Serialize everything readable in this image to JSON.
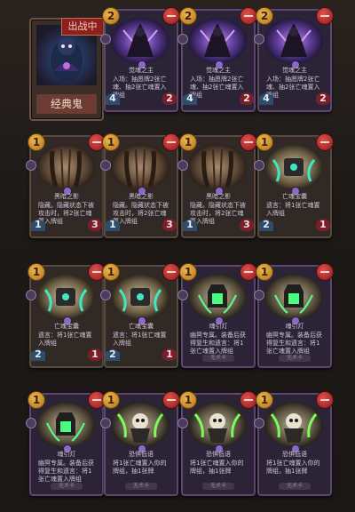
{
  "hero": {
    "tag": "出战中",
    "name": "经典鬼"
  },
  "cards": [
    {
      "cost": "2",
      "name": "觉魂之主",
      "desc": "入场：抽愿牌2张亡魂、抽2张亡魂置入牌组",
      "foot": "",
      "atk": "4",
      "hp": "2",
      "art": "violet",
      "frame": "purple"
    },
    {
      "cost": "2",
      "name": "觉魂之主",
      "desc": "入场：抽愿牌2张亡魂、抽2张亡魂置入牌组",
      "foot": "",
      "atk": "4",
      "hp": "2",
      "art": "violet",
      "frame": "purple"
    },
    {
      "cost": "2",
      "name": "觉魂之主",
      "desc": "入场：抽愿牌2张亡魂、抽2张亡魂置入牌组",
      "foot": "",
      "atk": "4",
      "hp": "2",
      "art": "violet",
      "frame": "purple"
    },
    {
      "cost": "1",
      "name": "黑暗之影",
      "desc": "隐藏。隐藏状态下被攻击时，将2张亡魂置入牌组",
      "foot": "",
      "atk": "1",
      "hp": "3",
      "art": "brown",
      "frame": "gold"
    },
    {
      "cost": "1",
      "name": "黑暗之影",
      "desc": "隐藏。隐藏状态下被攻击时，将2张亡魂置入牌组",
      "foot": "",
      "atk": "1",
      "hp": "3",
      "art": "brown",
      "frame": "gold"
    },
    {
      "cost": "1",
      "name": "黑暗之影",
      "desc": "隐藏。隐藏状态下被攻击时，将2张亡魂置入牌组",
      "foot": "",
      "atk": "1",
      "hp": "3",
      "art": "brown",
      "frame": "gold"
    },
    {
      "cost": "1",
      "name": "亡魂宝囊",
      "desc": "遗言：将1张亡魂置入牌组",
      "foot": "",
      "atk": "2",
      "hp": "1",
      "art": "teal",
      "frame": "gold"
    },
    {
      "cost": "1",
      "name": "亡魂宝囊",
      "desc": "遗言：将1张亡魂置入牌组",
      "foot": "",
      "atk": "2",
      "hp": "1",
      "art": "teal",
      "frame": "gold"
    },
    {
      "cost": "1",
      "name": "亡魂宝囊",
      "desc": "遗言：将1张亡魂置入牌组",
      "foot": "",
      "atk": "2",
      "hp": "1",
      "art": "teal",
      "frame": "gold"
    },
    {
      "cost": "1",
      "name": "魂引灯",
      "desc": "幽冥专属。装备后获得复生和遗言：将1张亡魂置入牌组",
      "foot": "无术卡",
      "atk": "",
      "hp": "",
      "art": "lantern",
      "frame": "purple"
    },
    {
      "cost": "1",
      "name": "魂引灯",
      "desc": "幽冥专属。装备后获得复生和遗言：将1张亡魂置入牌组",
      "foot": "无术卡",
      "atk": "",
      "hp": "",
      "art": "lantern",
      "frame": "purple"
    },
    {
      "cost": "1",
      "name": "魂引灯",
      "desc": "幽冥专属。装备后获得复生和遗言：将1张亡魂置入牌组",
      "foot": "无术卡",
      "atk": "",
      "hp": "",
      "art": "lantern",
      "frame": "purple"
    },
    {
      "cost": "1",
      "name": "恐惧低语",
      "desc": "将1张亡魂置入你的牌组，抽1张牌",
      "foot": "无术卡",
      "atk": "",
      "hp": "",
      "art": "skull",
      "frame": "purple"
    },
    {
      "cost": "1",
      "name": "恐惧低语",
      "desc": "将1张亡魂置入你的牌组，抽1张牌",
      "foot": "无术卡",
      "atk": "",
      "hp": "",
      "art": "skull",
      "frame": "purple"
    },
    {
      "cost": "1",
      "name": "恐惧低语",
      "desc": "将1张亡魂置入你的牌组，抽1张牌",
      "foot": "无术卡",
      "atk": "",
      "hp": "",
      "art": "skull",
      "frame": "purple"
    }
  ]
}
